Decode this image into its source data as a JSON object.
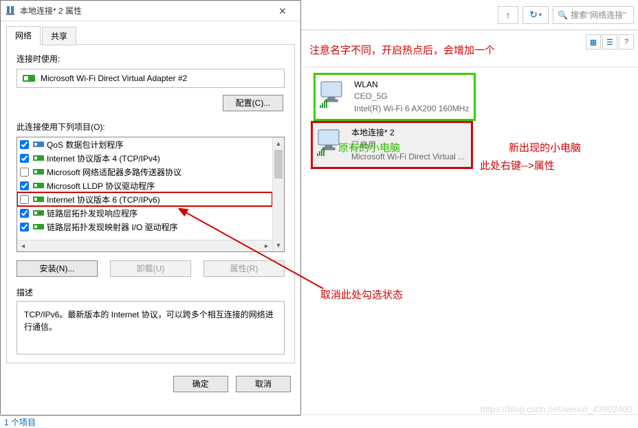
{
  "dialog": {
    "title": "本地连接* 2 属性",
    "tabs": {
      "network": "网络",
      "share": "共享"
    },
    "connect_using_label": "连接时使用:",
    "adapter": "Microsoft Wi-Fi Direct Virtual Adapter #2",
    "configure_btn": "配置(C)...",
    "items_label": "此连接使用下列项目(O):",
    "items": [
      {
        "checked": true,
        "icon": "qos",
        "label": "QoS 数据包计划程序"
      },
      {
        "checked": true,
        "icon": "proto",
        "label": "Internet 协议版本 4 (TCP/IPv4)"
      },
      {
        "checked": false,
        "icon": "proto",
        "label": "Microsoft 网络适配器多路传送器协议"
      },
      {
        "checked": true,
        "icon": "proto",
        "label": "Microsoft LLDP 协议驱动程序"
      },
      {
        "checked": false,
        "icon": "proto",
        "label": "Internet 协议版本 6 (TCP/IPv6)",
        "hl": true
      },
      {
        "checked": true,
        "icon": "proto",
        "label": "链路层拓扑发现响应程序"
      },
      {
        "checked": true,
        "icon": "proto",
        "label": "链路层拓扑发现映射器 I/O 驱动程序"
      }
    ],
    "install_btn": "安装(N)...",
    "uninstall_btn": "卸载(U)",
    "props_btn": "属性(R)",
    "desc_label": "描述",
    "desc_text": "TCP/IPv6。最新版本的 Internet 协议，可以跨多个相互连接的网络进行通信。",
    "ok": "确定",
    "cancel": "取消"
  },
  "explorer": {
    "search_placeholder": "搜索\"网络连接\"",
    "adapters": [
      {
        "name": "WLAN",
        "status": "CEO_5G",
        "device": "Intel(R) Wi-Fi 6 AX200 160MHz"
      },
      {
        "name": "本地连接* 2",
        "status": "已启用",
        "device": "Microsoft Wi-Fi Direct Virtual ..."
      }
    ],
    "status_text": "1 个项目"
  },
  "annotations": {
    "top": "注意名字不同，开启热点后，会增加一个",
    "green": "原有的小电脑",
    "red1": "新出现的小电脑",
    "red2": "此处右键-->属性",
    "cancel_check": "取消此处勾选状态"
  },
  "watermark": "https://blog.csdn.net/weixin_43902400"
}
